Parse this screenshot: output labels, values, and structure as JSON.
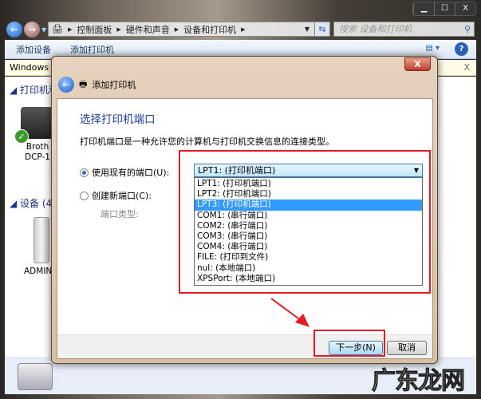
{
  "window": {
    "caption_buttons": [
      "▁",
      "☐",
      "X"
    ]
  },
  "address": {
    "breadcrumbs": [
      "控制面板",
      "硬件和声音",
      "设备和打印机"
    ],
    "search_placeholder": "搜索 设备和打印机"
  },
  "toolbar": {
    "add_device": "添加设备",
    "add_printer": "添加打印机",
    "help": "?"
  },
  "infobar": {
    "text": "Windows 可",
    "close": "X"
  },
  "explorer": {
    "groups": [
      {
        "label": "打印机和"
      },
      {
        "label": "设备 (4)"
      }
    ],
    "devices": [
      {
        "line1": "Broth",
        "line2": "DCP-1"
      },
      {
        "line1": "ADMIN"
      }
    ]
  },
  "dialog": {
    "close": "X",
    "title": "添加打印机",
    "heading": "选择打印机端口",
    "description": "打印机端口是一种允许您的计算机与打印机交换信息的连接类型。",
    "use_existing_label": "使用现有的端口(U):",
    "create_new_label": "创建新端口(C):",
    "port_type_label": "端口类型:",
    "selected_port": "LPT1: (打印机端口)",
    "port_options": [
      "LPT1: (打印机端口)",
      "LPT2: (打印机端口)",
      "LPT3: (打印机端口)",
      "COM1: (串行端口)",
      "COM2: (串行端口)",
      "COM3: (串行端口)",
      "COM4: (串行端口)",
      "FILE: (打印到文件)",
      "nul: (本地端口)",
      "XPSPort: (本地端口)"
    ],
    "highlighted_index": 2,
    "next_button": "下一步(N)",
    "cancel_button": "取消"
  },
  "watermark": "广东龙网",
  "colors": {
    "annotation": "#e21d25",
    "highlight": "#3399ff",
    "heading": "#1e3f9a"
  }
}
